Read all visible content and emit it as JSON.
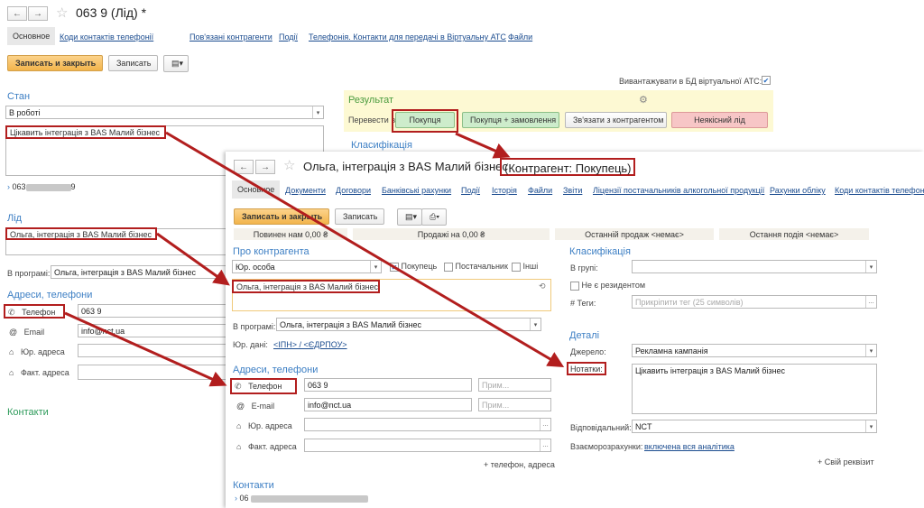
{
  "back": {
    "title": "063         9 (Лід) *",
    "tabs": [
      "Основное",
      "Коди контактів телефонії",
      "Пов'язані контрагенти",
      "Події",
      "Телефонія. Контакти для передачі в Віртуальну АТС",
      "Файли"
    ],
    "save_close": "Записать и закрыть",
    "save": "Записать",
    "export_label": "Вивантажувати в БД віртуальної АТС:",
    "stan_title": "Стан",
    "stan_value": "В роботі",
    "comment": "Цікавить інтеграція з BAS Малий бізнес",
    "phone_short": "063",
    "phone_tail": "9",
    "lid_title": "Лід",
    "lid_value": "Ольга, інтеграція з BAS Малий бізнес",
    "program_label": "В програмі:",
    "program_value": "Ольга, інтеграція з BAS Малий бізнес",
    "addr_title": "Адреси, телефони",
    "phone_label": "Телефон",
    "phone_value": "063        9",
    "email_label": "Email",
    "email_value": "info@nct.ua",
    "legal_addr": "Юр. адреса",
    "fact_addr": "Факт. адреса",
    "contacts": "Контакти",
    "result_title": "Результат",
    "convert_label": "Перевести в",
    "btn_buy": "Покупця",
    "btn_buy_order": "Покупця + замовлення",
    "btn_link": "Зв'язати з контрагентом",
    "btn_bad": "Неякісний лід",
    "classification": "Класифікація"
  },
  "front": {
    "title": "Ольга, інтеграція з BAS Малий бізнес",
    "title_suffix": "(Контрагент: Покупець)",
    "tabs": [
      "Основное",
      "Документи",
      "Договори",
      "Банківські рахунки",
      "Події",
      "Історія",
      "Файли",
      "Звіти",
      "Ліцензії постачальників алкогольної продукції",
      "Рахунки обліку",
      "Коди контактів телефонії"
    ],
    "save_close": "Записать и закрыть",
    "save": "Записать",
    "stats": [
      "Повинен нам 0,00 ₴",
      "Продажі на 0,00 ₴",
      "Останній продаж <немає>",
      "Остання подія <немає>"
    ],
    "about_title": "Про контрагента",
    "type_value": "Юр. особа",
    "cb_buyer": "Покупець",
    "cb_supplier": "Постачальник",
    "cb_other": "Інші",
    "name_value": "Ольга, інтеграція з BAS Малий бізнес",
    "program_label": "В програмі:",
    "program_value": "Ольга, інтеграція з BAS Малий бізнес",
    "legal_data_label": "Юр. дані:",
    "legal_data_link": "<ІПН> / <ЄДРПОУ>",
    "addr_title": "Адреси, телефони",
    "phone_label": "Телефон",
    "phone_value": "063        9",
    "email_label": "E-mail",
    "email_value": "info@nct.ua",
    "note_ph": "Прим...",
    "legal_addr": "Юр. адреса",
    "fact_addr": "Факт. адреса",
    "add_phone": "+ телефон, адреса",
    "contacts": "Контакти",
    "contact_value": "06",
    "class_title": "Класифікація",
    "group_label": "В групі:",
    "nonresident": "Не є резидентом",
    "tags_label": "Теги:",
    "tags_ph": "Прикріпити тег (25 символів)",
    "details_title": "Деталі",
    "source_label": "Джерело:",
    "source_value": "Рекламна кампанія",
    "notes_label": "Нотатки:",
    "notes_value": "Цікавить інтеграція з BAS Малий бізнес",
    "responsible_label": "Відповідальний:",
    "responsible_value": "NCT",
    "settlements_label": "Взаєморозрахунки:",
    "settlements_link": "включена вся аналітика",
    "own_req": "+ Свій реквізит"
  }
}
